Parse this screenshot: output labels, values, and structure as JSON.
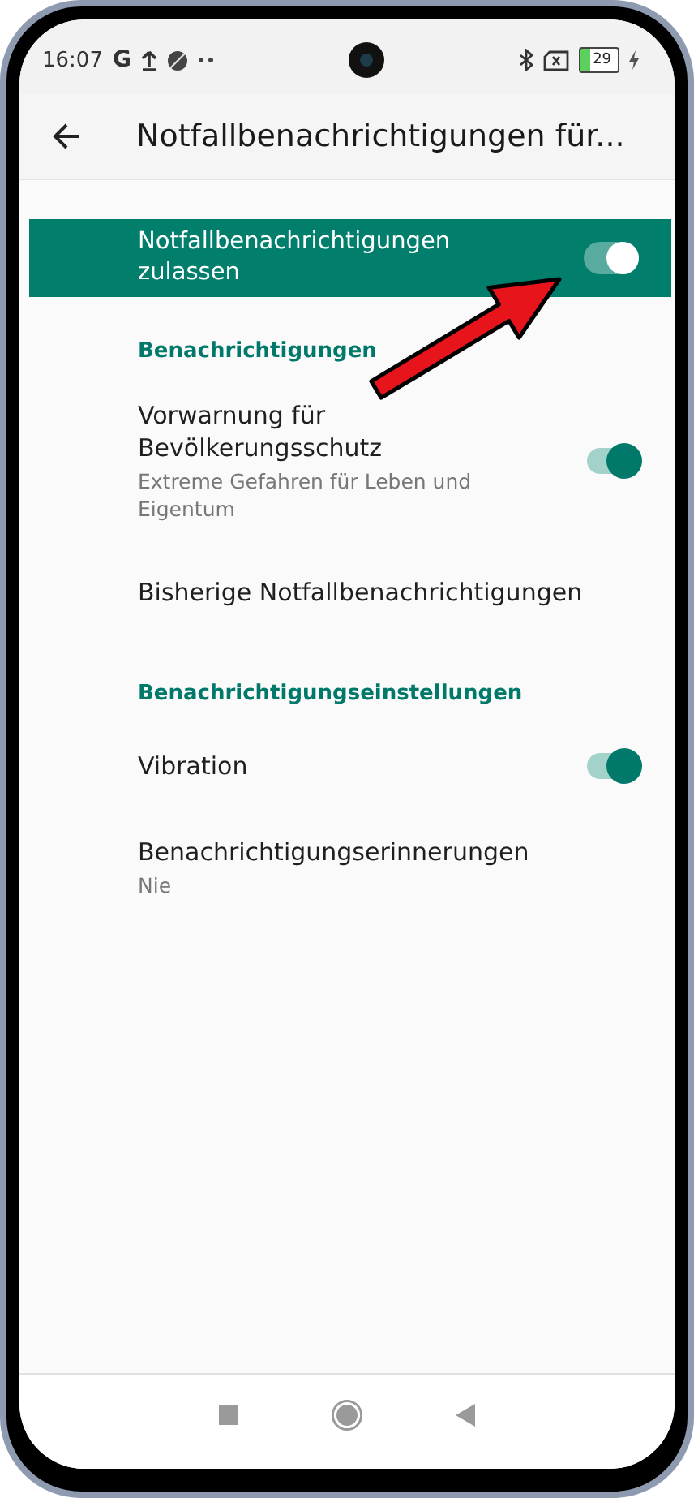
{
  "status_bar": {
    "time": "16:07",
    "network": "G",
    "battery": "29"
  },
  "app_bar": {
    "title": "Notfallbenachrichtigungen für..."
  },
  "master": {
    "label": "Notfallbenachrichtigungen zulassen",
    "on": true
  },
  "items": [
    {
      "kind": "header",
      "title": "Benachrichtigungen"
    },
    {
      "kind": "toggle",
      "title": "Vorwarnung für Bevölkerungsschutz",
      "subtitle": "Extreme Gefahren für Leben und Eigentum",
      "on": true
    },
    {
      "kind": "link",
      "title": "Bisherige Notfallbenachrichtigungen"
    },
    {
      "kind": "header",
      "title": "Benachrichtigungseinstellungen"
    },
    {
      "kind": "toggle",
      "title": "Vibration",
      "on": true
    },
    {
      "kind": "link",
      "title": "Benachrichtigungserinnerungen",
      "subtitle": "Nie"
    }
  ]
}
